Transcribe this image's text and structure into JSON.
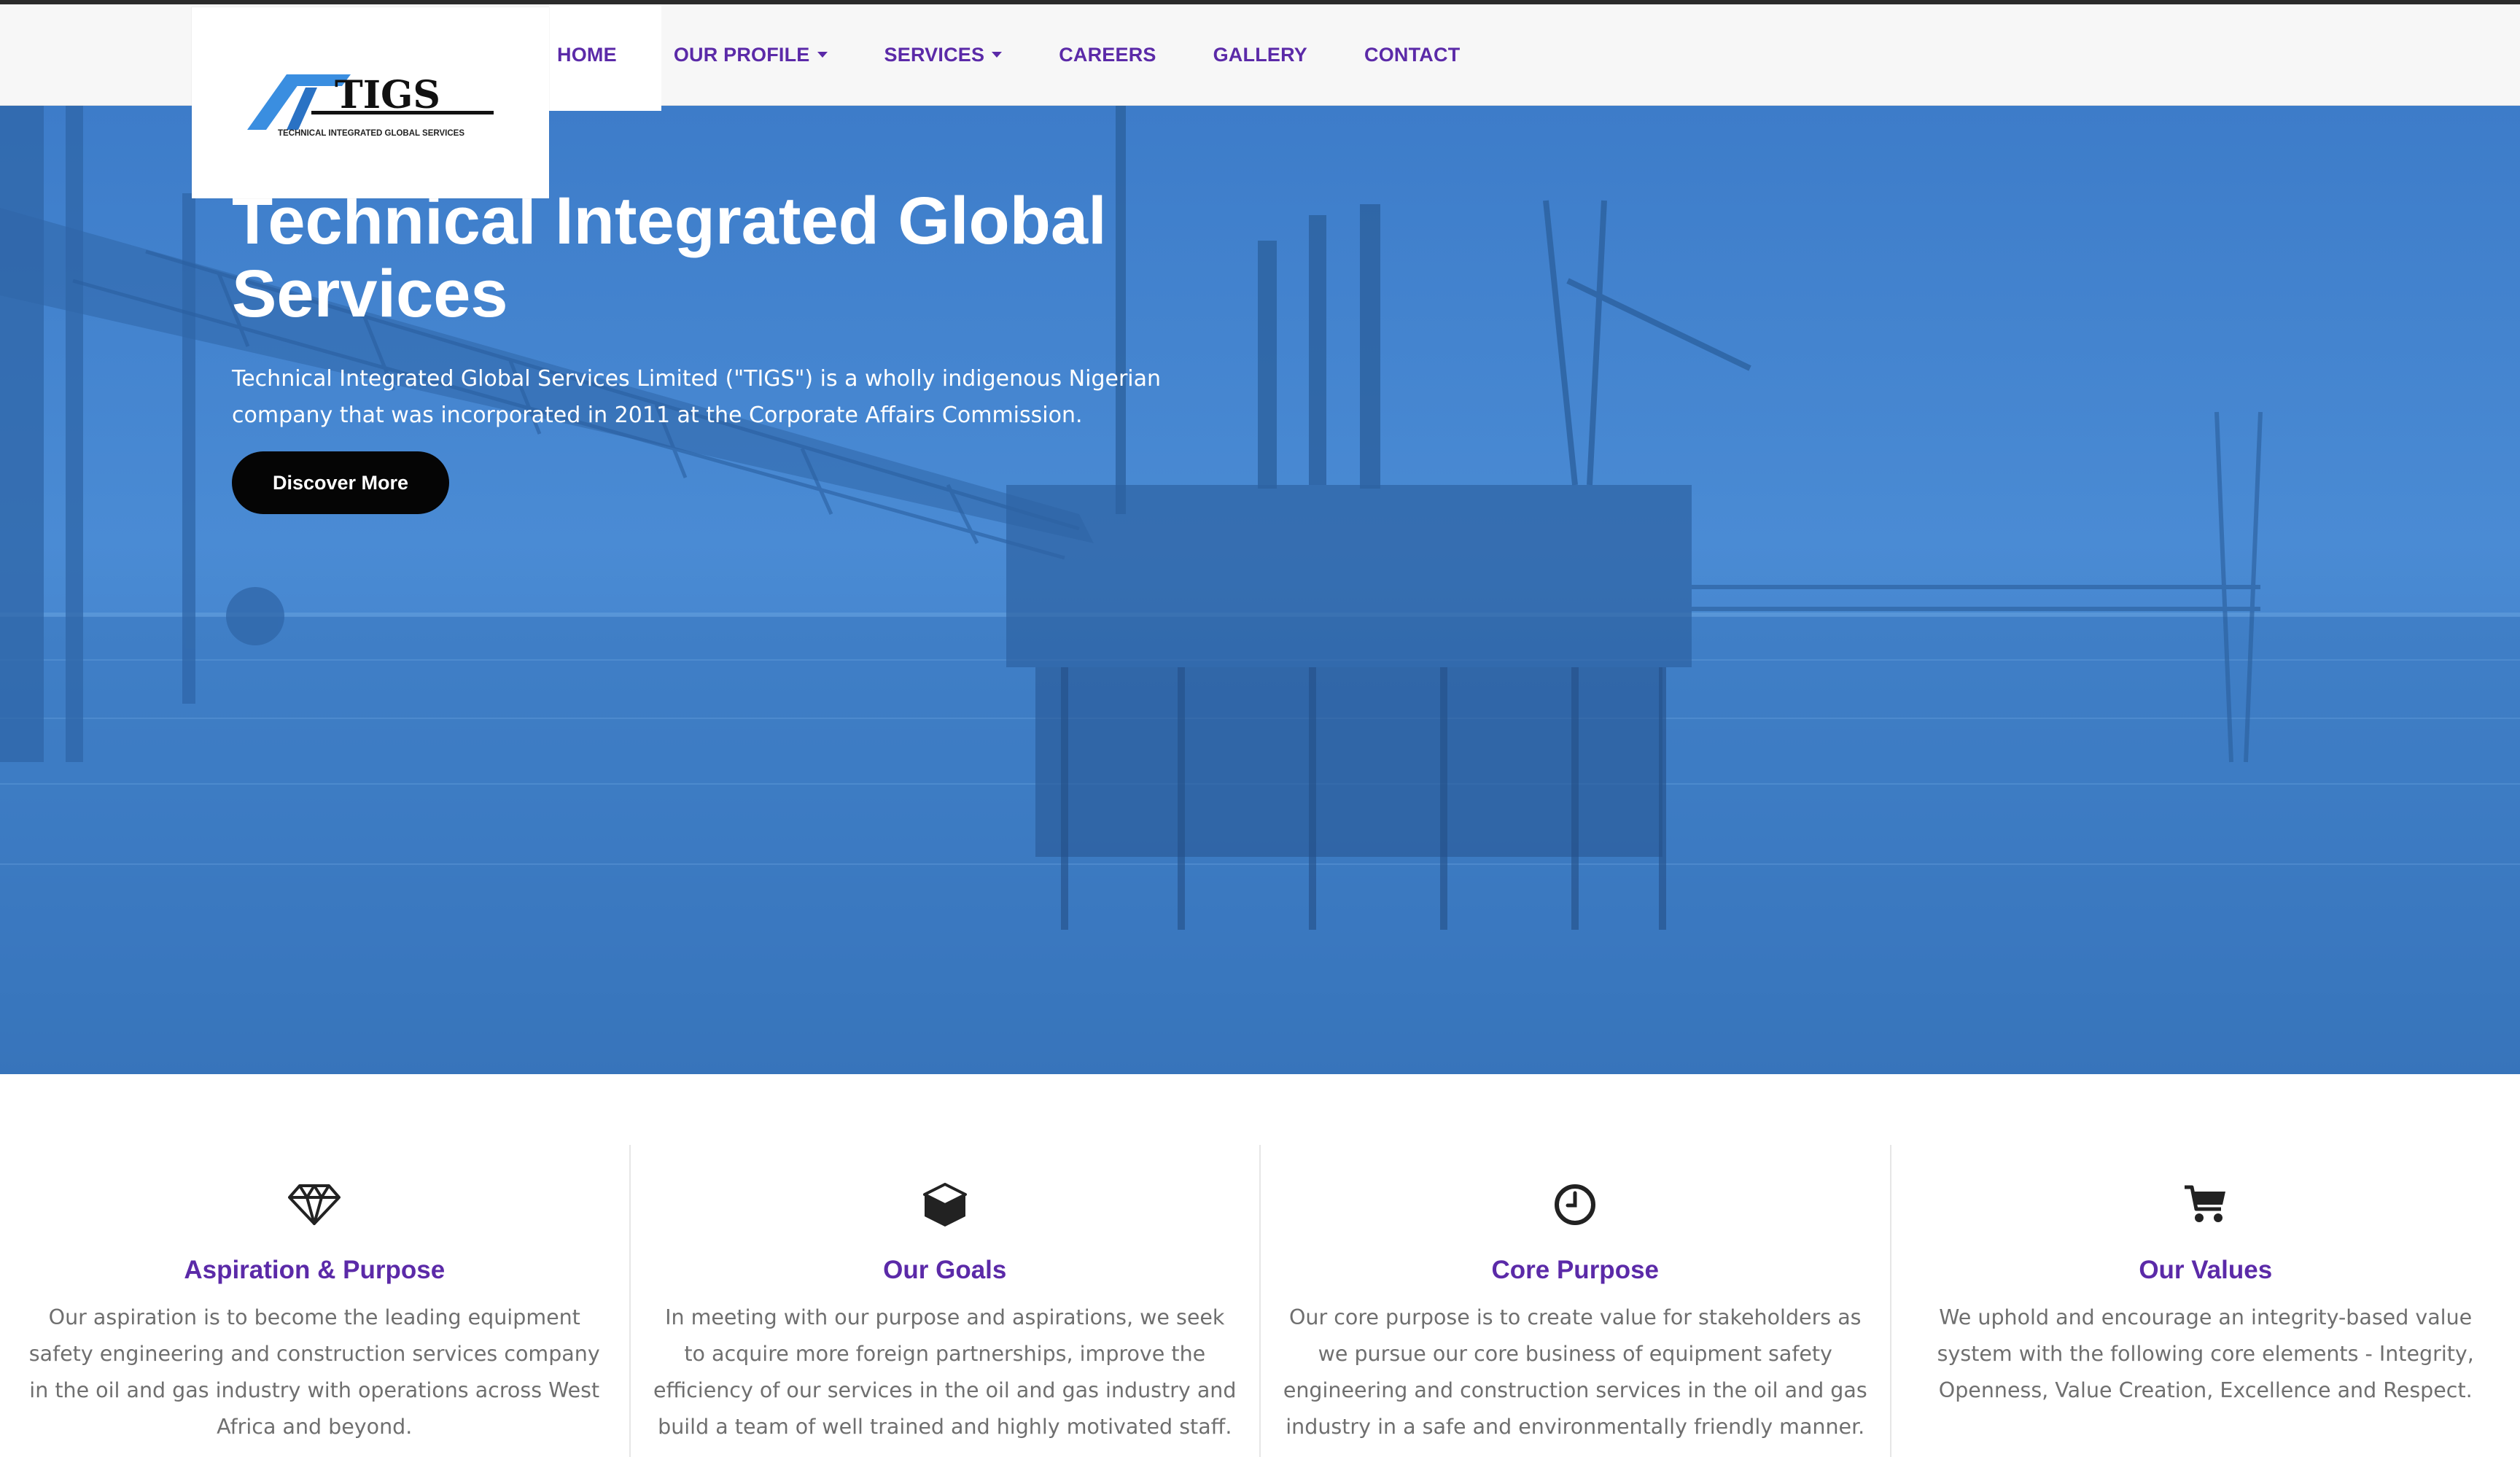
{
  "brand": {
    "logo_text": "TIGS",
    "logo_subtitle": "TECHNICAL INTEGRATED GLOBAL SERVICES"
  },
  "nav": {
    "items": [
      {
        "label": "HOME",
        "dropdown": false
      },
      {
        "label": "OUR PROFILE",
        "dropdown": true
      },
      {
        "label": "SERVICES",
        "dropdown": true
      },
      {
        "label": "CAREERS",
        "dropdown": false
      },
      {
        "label": "GALLERY",
        "dropdown": false
      },
      {
        "label": "CONTACT",
        "dropdown": false
      }
    ]
  },
  "hero": {
    "title": "Technical Integrated Global Services",
    "description": "Technical Integrated Global Services Limited (\"TIGS\") is a wholly indigenous Nigerian company that was incorporated in 2011 at the Corporate Affairs Commission.",
    "button_label": "Discover More"
  },
  "features": [
    {
      "icon": "diamond-icon",
      "title": "Aspiration & Purpose",
      "text": "Our aspiration is to become the leading equipment safety engineering and construction services company in the oil and gas industry with operations across West Africa and beyond."
    },
    {
      "icon": "cube-icon",
      "title": "Our Goals",
      "text": "In meeting with our purpose and aspirations, we seek to acquire more foreign partnerships, improve the efficiency of our services in the oil and gas industry and build a team of well trained and highly motivated staff."
    },
    {
      "icon": "clock-icon",
      "title": "Core Purpose",
      "text": "Our core purpose is to create value for stakeholders as we pursue our core business of equipment safety engineering and construction services in the oil and gas industry in a safe and environmentally friendly manner."
    },
    {
      "icon": "shopping-cart-icon",
      "title": "Our Values",
      "text": "We uphold and encourage an integrity-based value system with the following core elements - Integrity, Openness, Value Creation, Excellence and Respect."
    }
  ],
  "colors": {
    "accent": "#5b2aa8",
    "hero_overlay": "#4a8bd4",
    "button": "#050505",
    "body_text": "#6f6f6f"
  }
}
